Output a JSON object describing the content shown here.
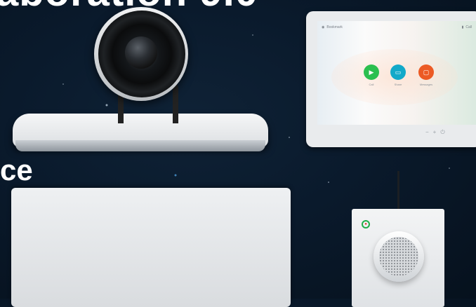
{
  "heading": {
    "title_fragment": "aboration 9.0",
    "subtitle_fragment": "ce"
  },
  "touch_panel": {
    "brand_text": "Bookmark",
    "status_text": "Call",
    "apps": [
      {
        "label": "Call",
        "color": "#2bbf4f",
        "icon": "video-camera-icon"
      },
      {
        "label": "Share",
        "color": "#12a9c9",
        "icon": "share-screen-icon"
      },
      {
        "label": "Messages",
        "color": "#ec5a24",
        "icon": "message-icon"
      }
    ]
  },
  "colors": {
    "background": "#0a1a2c",
    "device_white": "#eef0f2",
    "mic_ring": "#1fae4a"
  }
}
